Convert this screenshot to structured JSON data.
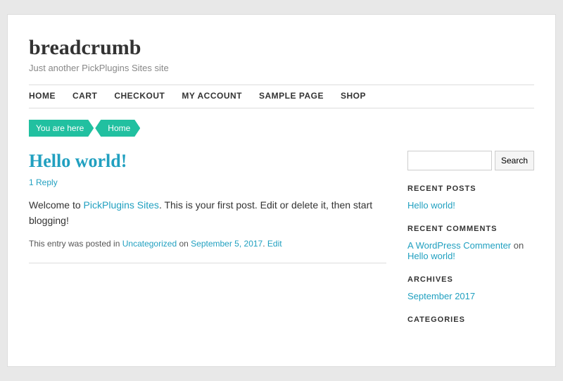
{
  "site": {
    "title": "breadcrumb",
    "tagline": "Just another PickPlugins Sites site"
  },
  "nav": {
    "items": [
      {
        "label": "HOME",
        "href": "#"
      },
      {
        "label": "CART",
        "href": "#"
      },
      {
        "label": "CHECKOUT",
        "href": "#"
      },
      {
        "label": "MY ACCOUNT",
        "href": "#"
      },
      {
        "label": "SAMPLE PAGE",
        "href": "#"
      },
      {
        "label": "SHOP",
        "href": "#"
      }
    ]
  },
  "breadcrumb": {
    "you_are_here": "You are here",
    "home": "Home"
  },
  "post": {
    "title": "Hello world!",
    "reply_text": "1 Reply",
    "body_start": "Welcome to ",
    "body_link": "PickPlugins Sites",
    "body_end": ". This is your first post. Edit or delete it, then start blogging!",
    "footer_prefix": "This entry was posted in ",
    "footer_category": "Uncategorized",
    "footer_on": " on ",
    "footer_date": "September 5, 2017",
    "footer_separator": ". ",
    "footer_edit": "Edit"
  },
  "sidebar": {
    "search": {
      "placeholder": "",
      "button_label": "Search"
    },
    "recent_posts": {
      "title": "RECENT POSTS",
      "items": [
        {
          "label": "Hello world!"
        }
      ]
    },
    "recent_comments": {
      "title": "RECENT COMMENTS",
      "commenter": "A WordPress Commenter",
      "on_text": " on ",
      "post_link": "Hello world!"
    },
    "archives": {
      "title": "ARCHIVES",
      "items": [
        {
          "label": "September 2017"
        }
      ]
    },
    "categories": {
      "title": "CATEGORIES"
    }
  }
}
